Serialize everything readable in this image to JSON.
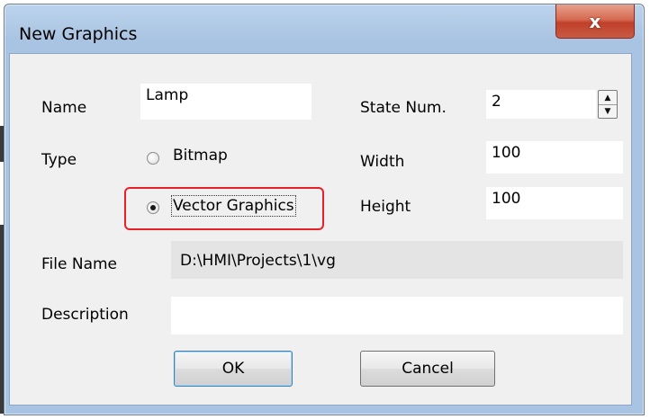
{
  "window": {
    "title": "New Graphics",
    "close_glyph": "x"
  },
  "form": {
    "name_label": "Name",
    "name_value": "Lamp",
    "state_num_label": "State Num.",
    "state_num_value": "2",
    "type_label": "Type",
    "type_options": [
      {
        "label": "Bitmap",
        "selected": false
      },
      {
        "label": "Vector Graphics",
        "selected": true
      }
    ],
    "width_label": "Width",
    "width_value": "100",
    "height_label": "Height",
    "height_value": "100",
    "file_name_label": "File Name",
    "file_name_value": "D:\\HMI\\Projects\\1\\vg",
    "description_label": "Description",
    "description_value": ""
  },
  "buttons": {
    "ok": "OK",
    "cancel": "Cancel"
  },
  "colors": {
    "title_bar": "#a9c4e2",
    "close_button": "#c0402a",
    "highlight_border": "#e8202a",
    "dialog_bg": "#f0f0f0"
  },
  "icons": {
    "spinner_up": "triangle-up-icon",
    "spinner_down": "triangle-down-icon",
    "close": "close-icon"
  }
}
